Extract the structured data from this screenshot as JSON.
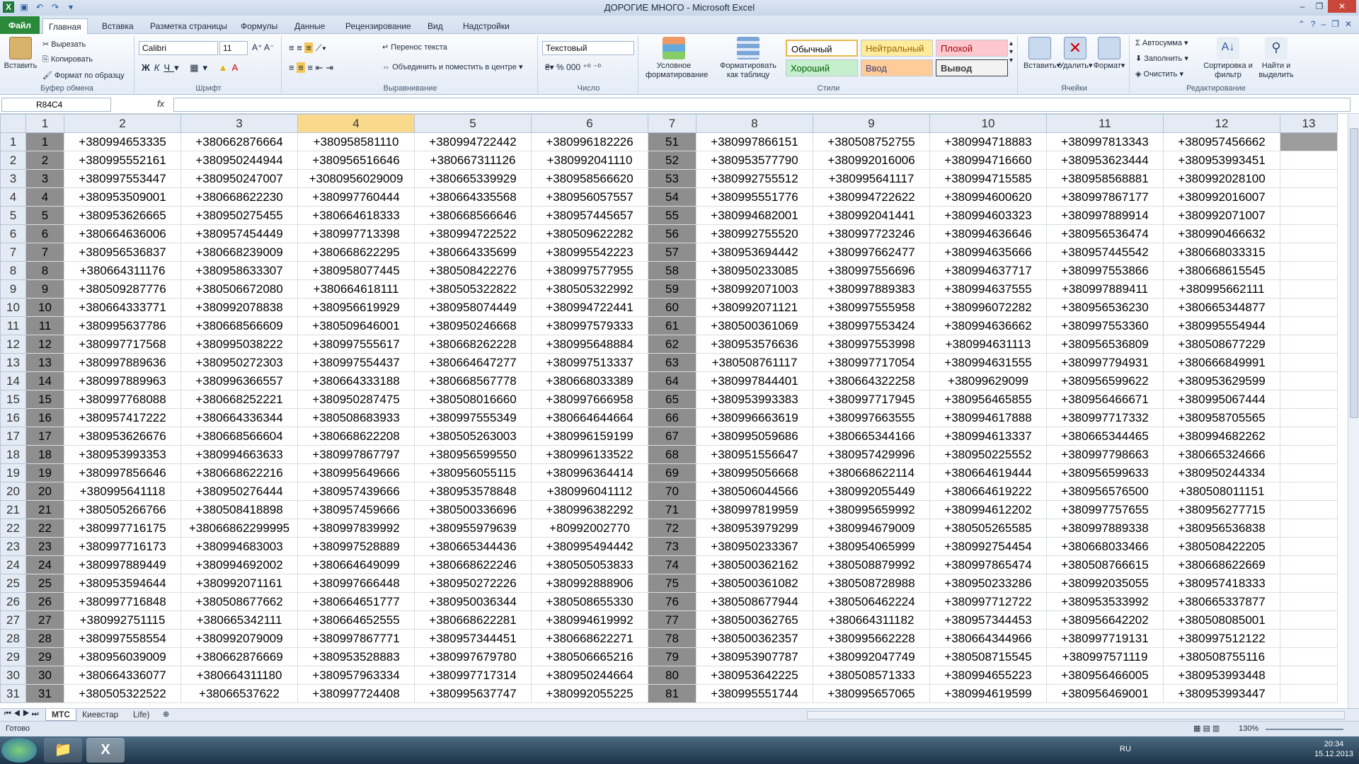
{
  "window": {
    "title": "ДОРОГИЕ МНОГО - Microsoft Excel"
  },
  "tabs": [
    "Файл",
    "Главная",
    "Вставка",
    "Разметка страницы",
    "Формулы",
    "Данные",
    "Рецензирование",
    "Вид",
    "Надстройки"
  ],
  "ribbon": {
    "clipboard": {
      "paste": "Вставить",
      "cut": "Вырезать",
      "copy": "Копировать",
      "format_painter": "Формат по образцу",
      "label": "Буфер обмена"
    },
    "font": {
      "name": "Calibri",
      "size": "11",
      "label": "Шрифт"
    },
    "alignment": {
      "wrap": "Перенос текста",
      "merge": "Объединить и поместить в центре",
      "label": "Выравнивание"
    },
    "number": {
      "format": "Текстовый",
      "label": "Число"
    },
    "styles": {
      "conditional": "Условное форматирование",
      "as_table": "Форматировать как таблицу",
      "normal": "Обычный",
      "neutral": "Нейтральный",
      "bad": "Плохой",
      "good": "Хороший",
      "input": "Ввод",
      "output": "Вывод",
      "label": "Стили"
    },
    "cells": {
      "insert": "Вставить",
      "delete": "Удалить",
      "format": "Формат",
      "label": "Ячейки"
    },
    "editing": {
      "autosum": "Автосумма",
      "fill": "Заполнить",
      "clear": "Очистить",
      "sort": "Сортировка и фильтр",
      "find": "Найти и выделить",
      "label": "Редактирование"
    }
  },
  "formula_bar": {
    "name_box": "R84C4",
    "fx": "fx",
    "value": ""
  },
  "grid": {
    "columns": [
      "1",
      "2",
      "3",
      "4",
      "5",
      "6",
      "7",
      "8",
      "9",
      "10",
      "11",
      "12",
      "13"
    ],
    "selected_column": "4",
    "rows": [
      [
        "1",
        "1",
        "+380994653335",
        "+380662876664",
        "+380958581110",
        "+380994722442",
        "+380996182226",
        "51",
        "+380997866151",
        "+380508752755",
        "+380994718883",
        "+380997813343",
        "+380957456662"
      ],
      [
        "2",
        "2",
        "+380995552161",
        "+380950244944",
        "+380956516646",
        "+380667311126",
        "+380992041110",
        "52",
        "+380953577790",
        "+380992016006",
        "+380994716660",
        "+380953623444",
        "+380953993451"
      ],
      [
        "3",
        "3",
        "+380997553447",
        "+380950247007",
        "+3080956029009",
        "+380665339929",
        "+380958566620",
        "53",
        "+380992755512",
        "+380995641117",
        "+380994715585",
        "+380958568881",
        "+380992028100"
      ],
      [
        "4",
        "4",
        "+380953509001",
        "+380668622230",
        "+380997760444",
        "+380664335568",
        "+380956057557",
        "54",
        "+380995551776",
        "+380994722622",
        "+380994600620",
        "+380997867177",
        "+380992016007"
      ],
      [
        "5",
        "5",
        "+380953626665",
        "+380950275455",
        "+380664618333",
        "+380668566646",
        "+380957445657",
        "55",
        "+380994682001",
        "+380992041441",
        "+380994603323",
        "+380997889914",
        "+380992071007"
      ],
      [
        "6",
        "6",
        "+380664636006",
        "+380957454449",
        "+380997713398",
        "+380994722522",
        "+380509622282",
        "56",
        "+380992755520",
        "+380997723246",
        "+380994636646",
        "+380956536474",
        "+380990466632"
      ],
      [
        "7",
        "7",
        "+380956536837",
        "+380668239009",
        "+380668622295",
        "+380664335699",
        "+380995542223",
        "57",
        "+380953694442",
        "+380997662477",
        "+380994635666",
        "+380957445542",
        "+380668033315"
      ],
      [
        "8",
        "8",
        "+380664311176",
        "+380958633307",
        "+380958077445",
        "+380508422276",
        "+380997577955",
        "58",
        "+380950233085",
        "+380997556696",
        "+380994637717",
        "+380997553866",
        "+380668615545"
      ],
      [
        "9",
        "9",
        "+380509287776",
        "+380506672080",
        "+380664618111",
        "+380505322822",
        "+380505322992",
        "59",
        "+380992071003",
        "+380997889383",
        "+380994637555",
        "+380997889411",
        "+380995662111"
      ],
      [
        "10",
        "10",
        "+380664333771",
        "+380992078838",
        "+380956619929",
        "+380958074449",
        "+380994722441",
        "60",
        "+380992071121",
        "+380997555958",
        "+380996072282",
        "+380956536230",
        "+380665344877"
      ],
      [
        "11",
        "11",
        "+380995637786",
        "+380668566609",
        "+380509646001",
        "+380950246668",
        "+380997579333",
        "61",
        "+380500361069",
        "+380997553424",
        "+380994636662",
        "+380997553360",
        "+380995554944"
      ],
      [
        "12",
        "12",
        "+380997717568",
        "+380995038222",
        "+380997555617",
        "+380668262228",
        "+380995648884",
        "62",
        "+380953576636",
        "+380997553998",
        "+380994631113",
        "+380956536809",
        "+380508677229"
      ],
      [
        "13",
        "13",
        "+380997889636",
        "+380950272303",
        "+380997554437",
        "+380664647277",
        "+380997513337",
        "63",
        "+380508761117",
        "+380997717054",
        "+380994631555",
        "+380997794931",
        "+380666849991"
      ],
      [
        "14",
        "14",
        "+380997889963",
        "+380996366557",
        "+380664333188",
        "+380668567778",
        "+380668033389",
        "64",
        "+380997844401",
        "+380664322258",
        "+38099629099",
        "+380956599622",
        "+380953629599"
      ],
      [
        "15",
        "15",
        "+380997768088",
        "+380668252221",
        "+380950287475",
        "+380508016660",
        "+380997666958",
        "65",
        "+380953993383",
        "+380997717945",
        "+380956465855",
        "+380956466671",
        "+380995067444"
      ],
      [
        "16",
        "16",
        "+380957417222",
        "+380664336344",
        "+380508683933",
        "+380997555349",
        "+380664644664",
        "66",
        "+380996663619",
        "+380997663555",
        "+380994617888",
        "+380997717332",
        "+380958705565"
      ],
      [
        "17",
        "17",
        "+380953626676",
        "+380668566604",
        "+380668622208",
        "+380505263003",
        "+380996159199",
        "67",
        "+380995059686",
        "+380665344166",
        "+380994613337",
        "+380665344465",
        "+380994682262"
      ],
      [
        "18",
        "18",
        "+380953993353",
        "+380994663633",
        "+380997867797",
        "+380956599550",
        "+380996133522",
        "68",
        "+380951556647",
        "+380957429996",
        "+380950225552",
        "+380997798663",
        "+380665324666"
      ],
      [
        "19",
        "19",
        "+380997856646",
        "+380668622216",
        "+380995649666",
        "+380956055115",
        "+380996364414",
        "69",
        "+380995056668",
        "+380668622114",
        "+380664619444",
        "+380956599633",
        "+380950244334"
      ],
      [
        "20",
        "20",
        "+380995641118",
        "+380950276444",
        "+380957439666",
        "+380953578848",
        "+380996041112",
        "70",
        "+380506044566",
        "+380992055449",
        "+380664619222",
        "+380956576500",
        "+380508011151"
      ],
      [
        "21",
        "21",
        "+380505266766",
        "+380508418898",
        "+380957459666",
        "+380500336696",
        "+380996382292",
        "71",
        "+380997819959",
        "+380995659992",
        "+380994612202",
        "+380997757655",
        "+380956277715"
      ],
      [
        "22",
        "22",
        "+380997716175",
        "+38066862299995",
        "+380997839992",
        "+380955979639",
        "+80992002770",
        "72",
        "+380953979299",
        "+380994679009",
        "+380505265585",
        "+380997889338",
        "+380956536838"
      ],
      [
        "23",
        "23",
        "+380997716173",
        "+380994683003",
        "+380997528889",
        "+380665344436",
        "+380995494442",
        "73",
        "+380950233367",
        "+380954065999",
        "+380992754454",
        "+380668033466",
        "+380508422205"
      ],
      [
        "24",
        "24",
        "+380997889449",
        "+380994692002",
        "+380664649099",
        "+380668622246",
        "+380505053833",
        "74",
        "+380500362162",
        "+380508879992",
        "+380997865474",
        "+380508766615",
        "+380668622669"
      ],
      [
        "25",
        "25",
        "+380953594644",
        "+380992071161",
        "+380997666448",
        "+380950272226",
        "+380992888906",
        "75",
        "+380500361082",
        "+380508728988",
        "+380950233286",
        "+380992035055",
        "+380957418333"
      ],
      [
        "26",
        "26",
        "+380997716848",
        "+380508677662",
        "+380664651777",
        "+380950036344",
        "+380508655330",
        "76",
        "+380508677944",
        "+380506462224",
        "+380997712722",
        "+380953533992",
        "+380665337877"
      ],
      [
        "27",
        "27",
        "+380992751115",
        "+380665342111",
        "+380664652555",
        "+380668622281",
        "+380994619992",
        "77",
        "+380500362765",
        "+380664311182",
        "+380957344453",
        "+380956642202",
        "+380508085001"
      ],
      [
        "28",
        "28",
        "+380997558554",
        "+380992079009",
        "+380997867771",
        "+380957344451",
        "+380668622271",
        "78",
        "+380500362357",
        "+380995662228",
        "+380664344966",
        "+380997719131",
        "+380997512122"
      ],
      [
        "29",
        "29",
        "+380956039009",
        "+380662876669",
        "+380953528883",
        "+380997679780",
        "+380506665216",
        "79",
        "+380953907787",
        "+380992047749",
        "+380508715545",
        "+380997571119",
        "+380508755116"
      ],
      [
        "30",
        "30",
        "+380664336077",
        "+380664311180",
        "+380957963334",
        "+380997717314",
        "+380950244664",
        "80",
        "+380953642225",
        "+380508571333",
        "+380994655223",
        "+380956466005",
        "+380953993448"
      ],
      [
        "31",
        "31",
        "+380505322522",
        "+38066537622",
        "+380997724408",
        "+380995637747",
        "+380992055225",
        "81",
        "+380995551744",
        "+380995657065",
        "+380994619599",
        "+380956469001",
        "+380953993447"
      ]
    ]
  },
  "sheets": [
    "МТС",
    "Киевстар",
    "Life)"
  ],
  "status": {
    "ready": "Готово",
    "zoom": "130%"
  },
  "taskbar": {
    "lang": "RU",
    "time": "20:34",
    "date": "15.12.2013"
  }
}
